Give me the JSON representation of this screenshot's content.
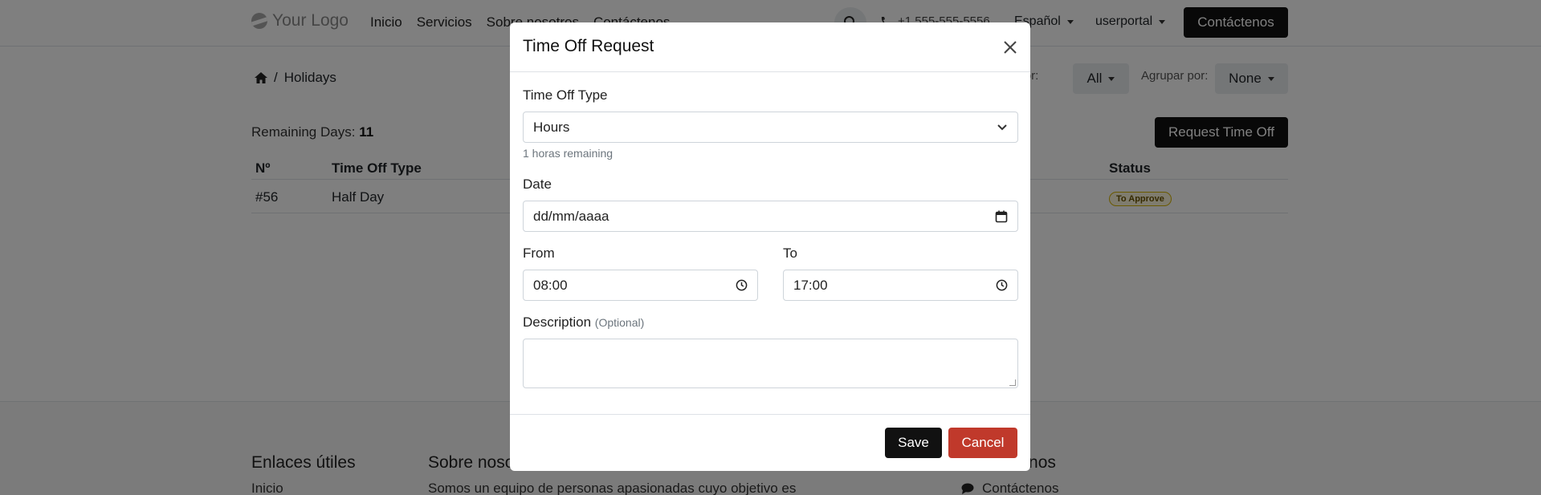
{
  "navbar": {
    "logo_text": "Your Logo",
    "links": [
      "Inicio",
      "Servicios",
      "Sobre nosotros",
      "Contáctenos"
    ],
    "phone": "+1 555-555-5556",
    "language": "Español",
    "user": "userportal",
    "cta_label": "Contáctenos"
  },
  "breadcrumb": {
    "current": "Holidays"
  },
  "filters": {
    "filter_label": "Filtrar por:",
    "filter_value": "All",
    "group_label": "Agrupar por:",
    "group_value": "None"
  },
  "summary": {
    "remaining_label": "Remaining Days:",
    "remaining_value": "11",
    "request_button": "Request Time Off"
  },
  "table": {
    "headers": {
      "number": "Nº",
      "type": "Time Off Type",
      "status": "Status"
    },
    "rows": [
      {
        "number": "#56",
        "type": "Half Day",
        "status": "To Approve"
      }
    ]
  },
  "footer": {
    "col1_title": "Enlaces útiles",
    "col1_link": "Inicio",
    "col2_title": "Sobre nosotros",
    "col2_text": "Somos un equipo de personas apasionadas cuyo objetivo es",
    "col3_title": "Contáctenos",
    "col3_link": "Contáctenos"
  },
  "modal": {
    "title": "Time Off Request",
    "type_label": "Time Off Type",
    "type_value": "Hours",
    "type_help": "1 horas remaining",
    "date_label": "Date",
    "date_placeholder": "dd/mm/aaaa",
    "from_label": "From",
    "from_value": "08:00",
    "to_label": "To",
    "to_value": "17:00",
    "description_label": "Description",
    "description_optional": "(Optional)",
    "save_label": "Save",
    "cancel_label": "Cancel"
  },
  "colors": {
    "primary": "#111111",
    "danger": "#c0392b",
    "badge_warning": "#d4b200"
  }
}
